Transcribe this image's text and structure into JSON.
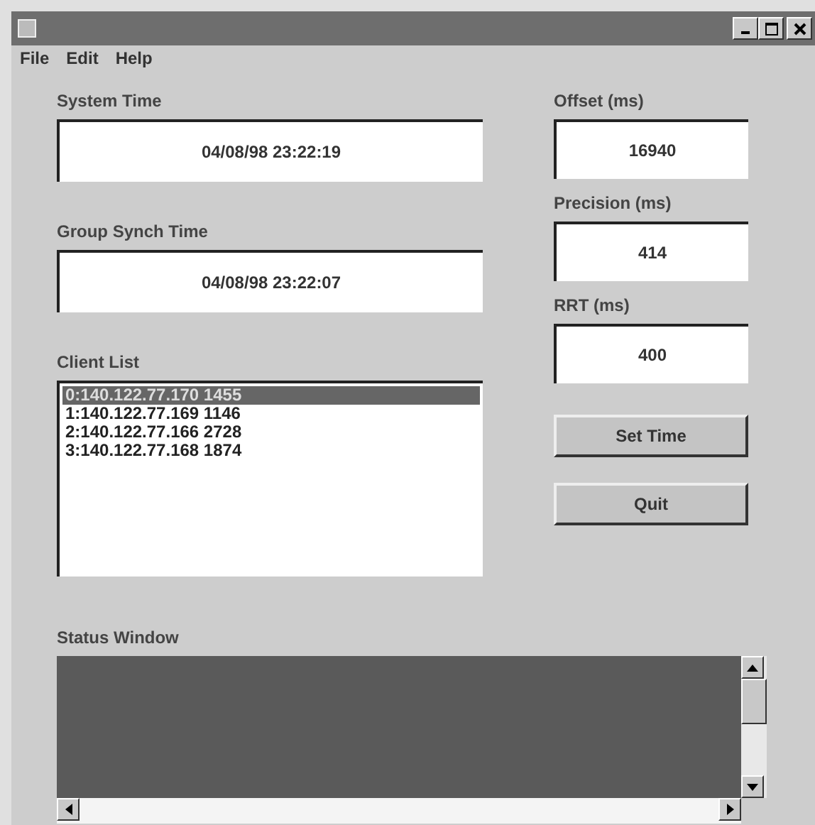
{
  "menu": [
    {
      "label": "File"
    },
    {
      "label": "Edit"
    },
    {
      "label": "Help"
    }
  ],
  "fields_left": [
    {
      "label": "System Time",
      "value": "04/08/98 23:22:19"
    },
    {
      "label": "Group Synch Time",
      "value": "04/08/98 23:22:07"
    }
  ],
  "client_list": {
    "label": "Client List",
    "items": [
      {
        "text": "0:140.122.77.170 1455",
        "selected": true
      },
      {
        "text": "1:140.122.77.169 1146",
        "selected": false
      },
      {
        "text": "2:140.122.77.166 2728",
        "selected": false
      },
      {
        "text": "3:140.122.77.168 1874",
        "selected": false
      }
    ]
  },
  "fields_right": [
    {
      "label": "Offset (ms)",
      "value": "16940"
    },
    {
      "label": "Precision (ms)",
      "value": "414"
    },
    {
      "label": "RRT (ms)",
      "value": "400"
    }
  ],
  "buttons": [
    "Set Time",
    "Quit"
  ],
  "status_window": {
    "label": "Status Window"
  }
}
